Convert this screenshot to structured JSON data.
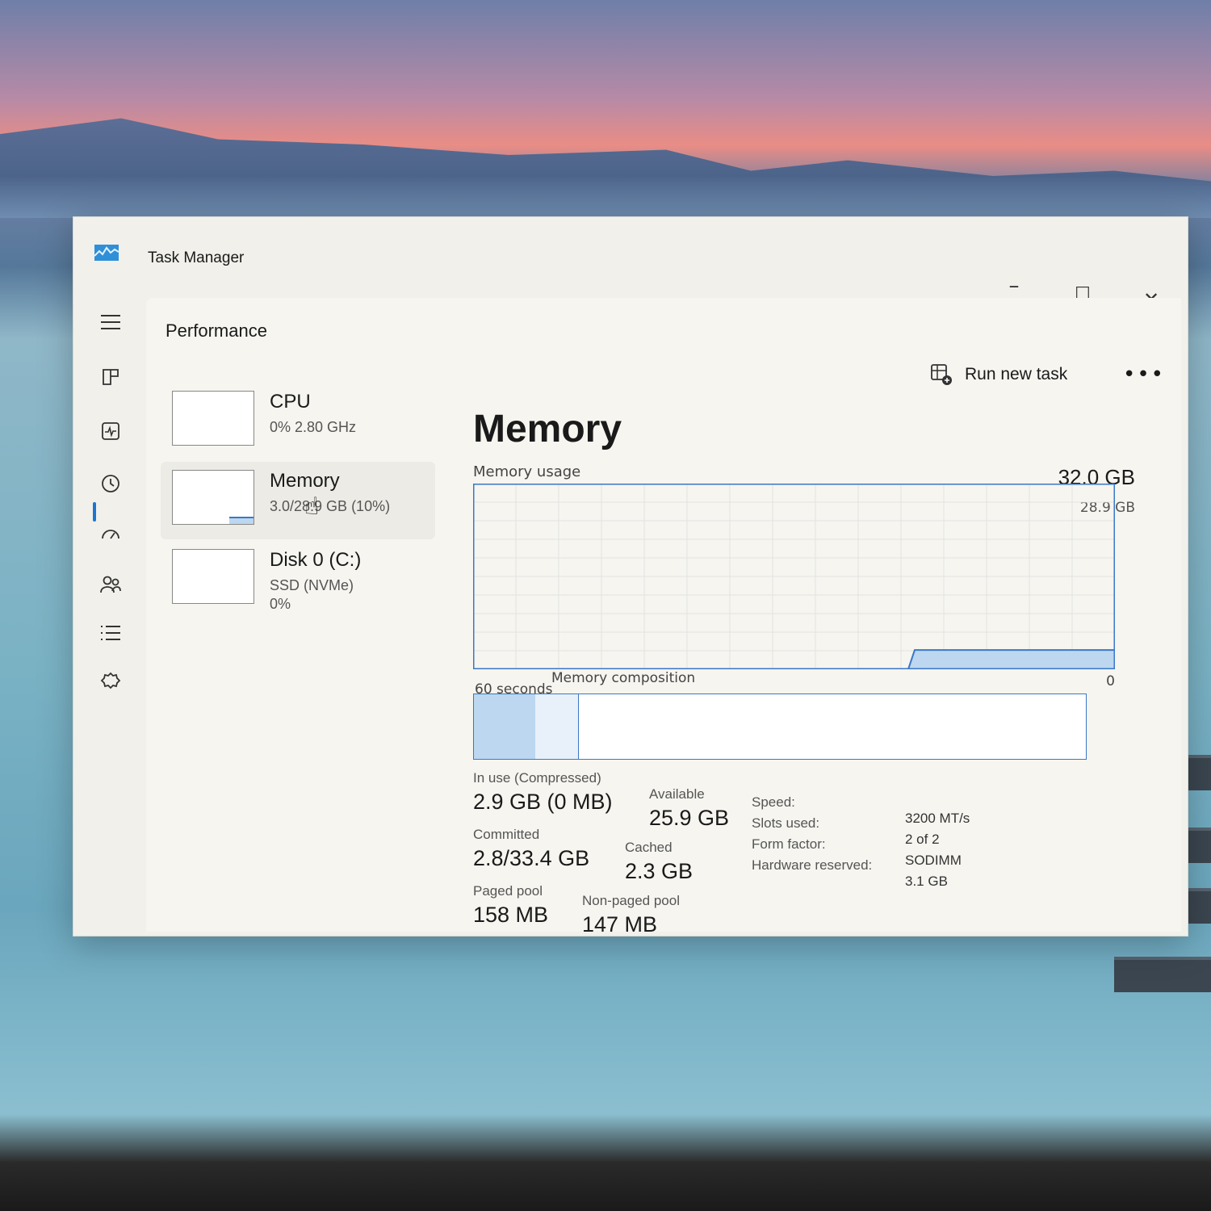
{
  "window": {
    "title": "Task Manager"
  },
  "header": {
    "page_title": "Performance",
    "run_new_task": "Run new task",
    "more": "•••",
    "minimize": "–",
    "maximize": "☐",
    "close": "✕"
  },
  "nav": {
    "items": [
      {
        "icon": "hamburger-icon"
      },
      {
        "icon": "processes-icon"
      },
      {
        "icon": "performance-icon"
      },
      {
        "icon": "app-history-icon"
      },
      {
        "icon": "startup-apps-icon"
      },
      {
        "icon": "users-icon"
      },
      {
        "icon": "details-icon"
      },
      {
        "icon": "services-icon"
      }
    ],
    "settings_icon": "gear-icon"
  },
  "resources": [
    {
      "title": "CPU",
      "sub": "0%  2.80 GHz",
      "sub2": ""
    },
    {
      "title": "Memory",
      "sub": "3.0/28.9 GB (10%)",
      "sub2": "",
      "fill": 0.1
    },
    {
      "title": "Disk 0 (C:)",
      "sub": "SSD (NVMe)",
      "sub2": "0%"
    }
  ],
  "detail": {
    "title": "Memory",
    "usage_label": "Memory usage",
    "usage_max": "32.0 GB",
    "usage_sub": "28.9 GB",
    "x_label": "60 seconds",
    "y_min_label": "0",
    "composition_label": "Memory composition",
    "composition": {
      "in_use_fraction": 0.1,
      "modified_fraction": 0.07
    },
    "stats": {
      "in_use_label": "In use (Compressed)",
      "in_use_value": "2.9 GB (0 MB)",
      "available_label": "Available",
      "available_value": "25.9 GB",
      "committed_label": "Committed",
      "committed_value": "2.8/33.4 GB",
      "cached_label": "Cached",
      "cached_value": "2.3 GB",
      "paged_label": "Paged pool",
      "paged_value": "158 MB",
      "nonpaged_label": "Non-paged pool",
      "nonpaged_value": "147 MB"
    },
    "specs": [
      {
        "label": "Speed:",
        "value": "3200 MT/s"
      },
      {
        "label": "Slots used:",
        "value": "2 of 2"
      },
      {
        "label": "Form factor:",
        "value": "SODIMM"
      },
      {
        "label": "Hardware reserved:",
        "value": "3.1 GB"
      }
    ]
  },
  "chart_data": {
    "type": "area",
    "title": "Memory usage",
    "xlabel": "60 seconds",
    "ylabel": "",
    "ylim": [
      0,
      28.9
    ],
    "series": [
      {
        "values": [
          0,
          0,
          0,
          0,
          0,
          0,
          0,
          0,
          0,
          0,
          0,
          0,
          0,
          0,
          0,
          0,
          0,
          0,
          0,
          0,
          0,
          0,
          0,
          0,
          0,
          0,
          0,
          0,
          0,
          0,
          0,
          0,
          0,
          0,
          0,
          0,
          0,
          0,
          0,
          0,
          3.0,
          3.0,
          3.0,
          3.0,
          3.0,
          3.0,
          3.0,
          3.0,
          3.0,
          3.0,
          3.0,
          3.0,
          3.0,
          3.0,
          3.0,
          3.0,
          3.0,
          3.0,
          3.0,
          3.0
        ]
      }
    ],
    "grid": true
  }
}
